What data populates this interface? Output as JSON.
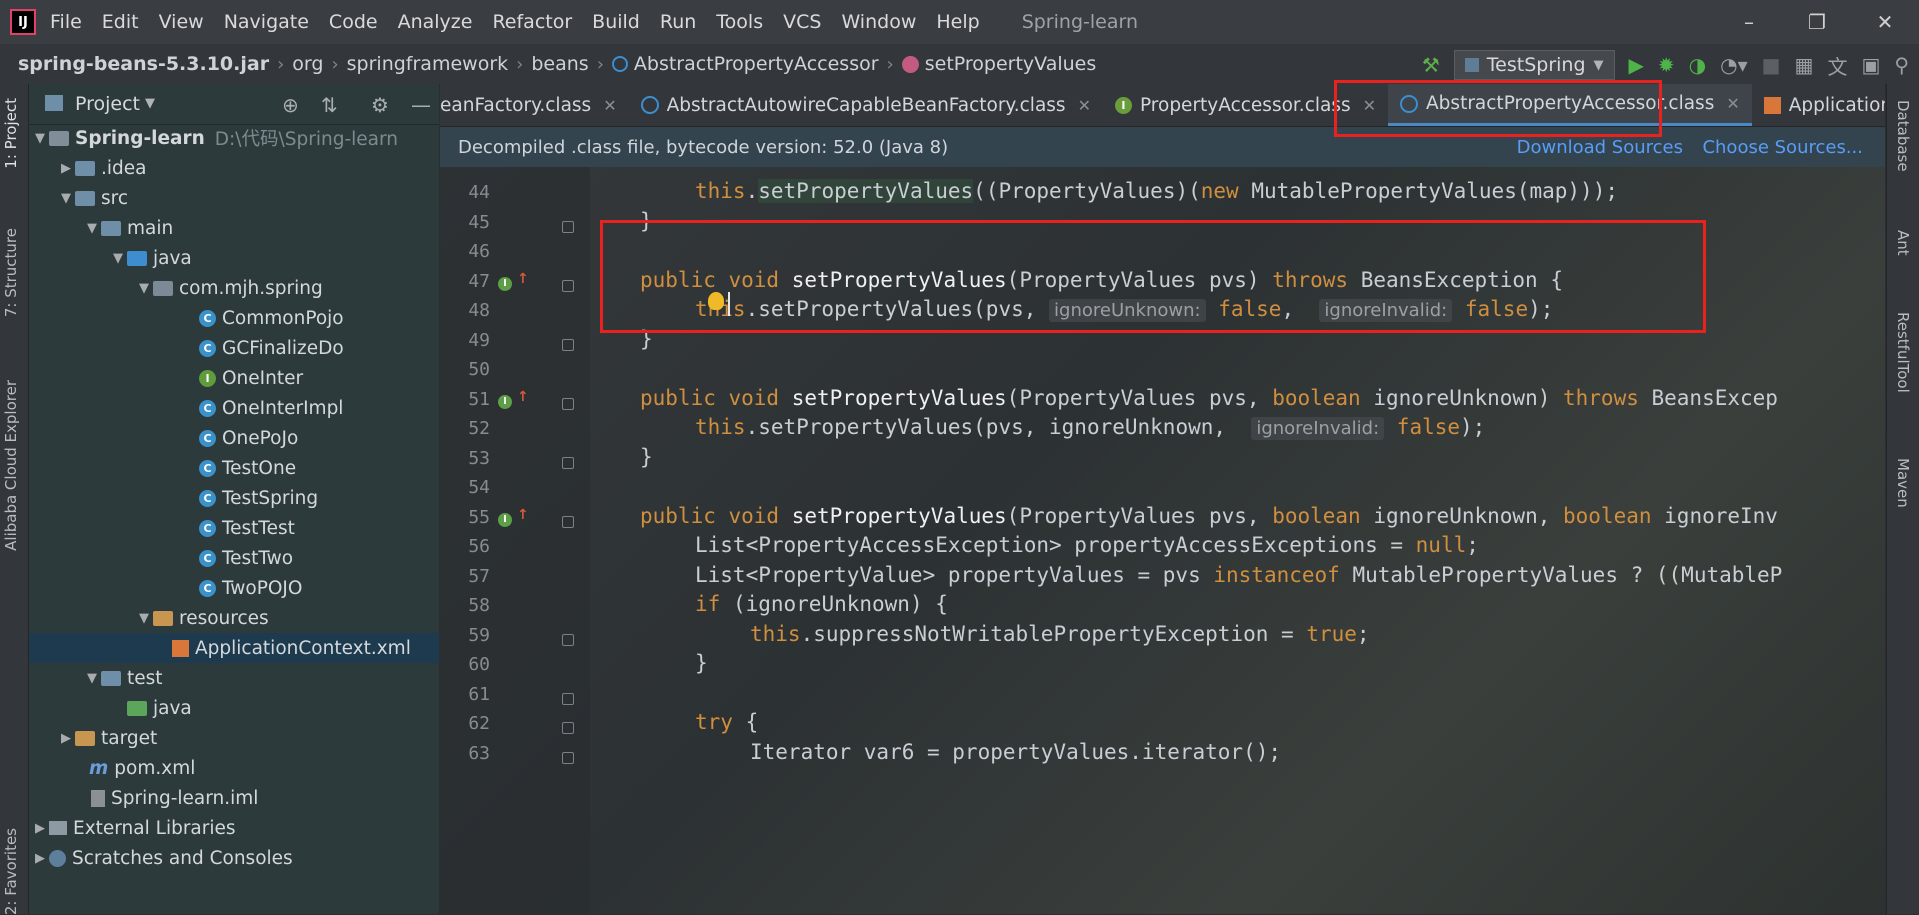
{
  "menubar": {
    "logo": "IJ",
    "items": [
      "File",
      "Edit",
      "View",
      "Navigate",
      "Code",
      "Analyze",
      "Refactor",
      "Build",
      "Run",
      "Tools",
      "VCS",
      "Window",
      "Help"
    ],
    "window_title": "Spring-learn",
    "controls": {
      "minimize": "–",
      "restore": "❐",
      "close": "✕"
    }
  },
  "breadcrumb": {
    "items": [
      "spring-beans-5.3.10.jar",
      "org",
      "springframework",
      "beans",
      "AbstractPropertyAccessor",
      "setPropertyValues"
    ],
    "separator": "›"
  },
  "run_toolbar": {
    "config": "TestSpring",
    "icons": [
      "hammer-icon",
      "run-icon",
      "debug-icon",
      "coverage-icon",
      "profile-icon",
      "stop-icon",
      "project-structure-icon",
      "translate-icon",
      "terminal-icon",
      "search-icon"
    ]
  },
  "left_strip": {
    "tabs": [
      "1: Project",
      "7: Structure",
      "Alibaba Cloud Explorer",
      "2: Favorites"
    ]
  },
  "project_panel": {
    "title": "Project",
    "tree": [
      {
        "label": "Spring-learn",
        "hint": "D:\\代码\\Spring-learn",
        "bold": true
      },
      {
        "label": ".idea"
      },
      {
        "label": "src"
      },
      {
        "label": "main"
      },
      {
        "label": "java"
      },
      {
        "label": "com.mjh.spring"
      },
      {
        "label": "CommonPojo"
      },
      {
        "label": "GCFinalizeDo"
      },
      {
        "label": "OneInter"
      },
      {
        "label": "OneInterImpl"
      },
      {
        "label": "OnePoJo"
      },
      {
        "label": "TestOne"
      },
      {
        "label": "TestSpring"
      },
      {
        "label": "TestTest"
      },
      {
        "label": "TestTwo"
      },
      {
        "label": "TwoPOJO"
      },
      {
        "label": "resources"
      },
      {
        "label": "ApplicationContext.xml"
      },
      {
        "label": "test"
      },
      {
        "label": "java"
      },
      {
        "label": "target"
      },
      {
        "label": "pom.xml"
      },
      {
        "label": "Spring-learn.iml"
      },
      {
        "label": "External Libraries"
      },
      {
        "label": "Scratches and Consoles"
      }
    ]
  },
  "editor_tabs": [
    {
      "label": "eanFactory.class"
    },
    {
      "label": "AbstractAutowireCapableBeanFactory.class"
    },
    {
      "label": "PropertyAccessor.class"
    },
    {
      "label": "AbstractPropertyAccessor.class",
      "active": true
    },
    {
      "label": "ApplicationCon"
    }
  ],
  "banner": {
    "text": "Decompiled .class file, bytecode version: 52.0 (Java 8)",
    "download": "Download Sources",
    "choose": "Choose Sources..."
  },
  "editor": {
    "line_numbers": [
      "44",
      "45",
      "46",
      "47",
      "48",
      "49",
      "50",
      "51",
      "52",
      "53",
      "54",
      "55",
      "56",
      "57",
      "58",
      "59",
      "60",
      "61",
      "62",
      "63"
    ],
    "hints": {
      "ignoreUnknown": "ignoreUnknown:",
      "ignoreInvalid": "ignoreInvalid:"
    }
  },
  "right_strip": {
    "tabs": [
      "Database",
      "Ant",
      "RestfulTool",
      "Maven"
    ]
  },
  "colors": {
    "keyword": "#d08f3f",
    "annotation_red": "#e8221e",
    "link": "#589df6",
    "active_tab_underline": "#4a88c7"
  }
}
